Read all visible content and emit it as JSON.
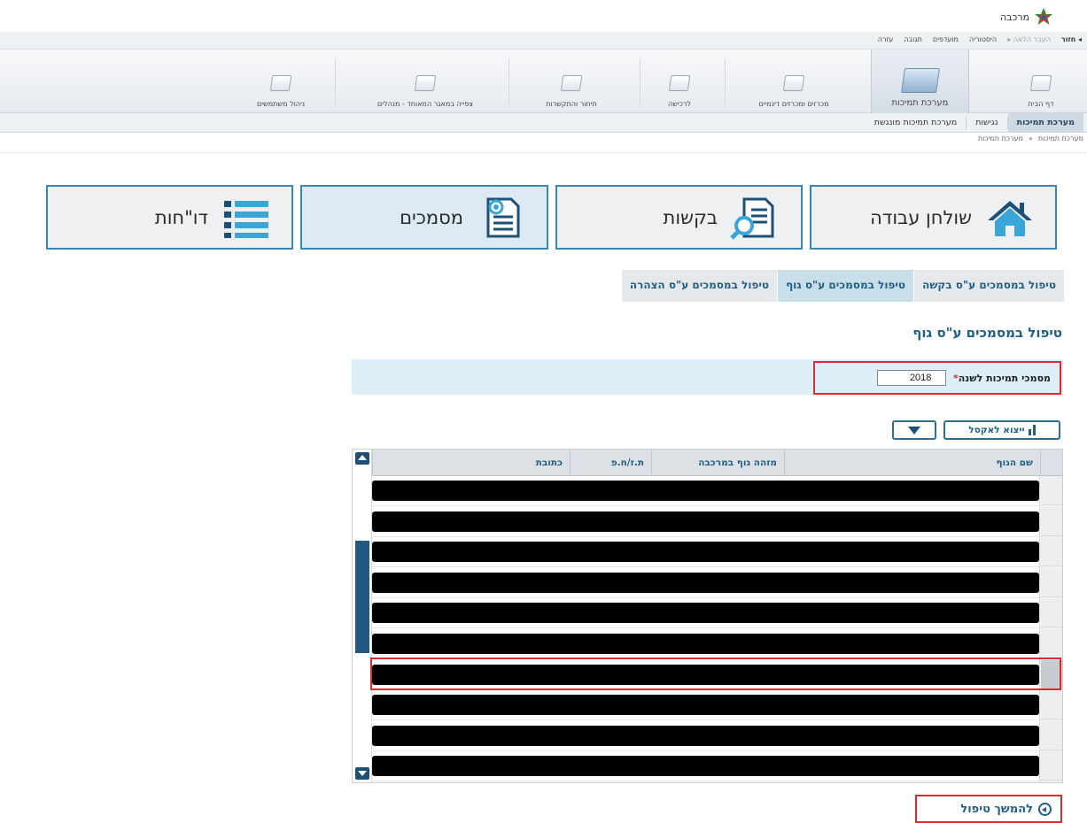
{
  "app": {
    "name": "מרכבה"
  },
  "history_bar": {
    "back": "חזור",
    "next_disabled": "העבר הלאה",
    "history": "היסטוריה",
    "favorites": "מועדפים",
    "feedback": "תגובה",
    "help": "עזרה"
  },
  "modules": [
    {
      "label": "דף הבית"
    },
    {
      "label": "מערכת תמיכות"
    },
    {
      "label": "מכרזים ומכרזים דינמיים"
    },
    {
      "label": "לרכישה"
    },
    {
      "label": "תיחור והתקשרות"
    },
    {
      "label": "צפייה במאגר המאוחד - מנהלים"
    },
    {
      "label": "ניהול משתמשים"
    }
  ],
  "subnav": [
    {
      "label": "מערכת תמיכות"
    },
    {
      "label": "נגישות"
    },
    {
      "label": "מערכת תמיכות מונגשת"
    }
  ],
  "breadcrumb": {
    "items": [
      "מערכת תמיכות",
      "»",
      "מערכת תמיכות"
    ]
  },
  "tiles": [
    {
      "label": "שולחן עבודה",
      "icon": "home-icon"
    },
    {
      "label": "בקשות",
      "icon": "document-search-icon"
    },
    {
      "label": "מסמכים",
      "icon": "documents-icon"
    },
    {
      "label": "דו\"חות",
      "icon": "list-icon"
    }
  ],
  "subtabs": [
    {
      "label": "טיפול במסמכים ע\"ס בקשה"
    },
    {
      "label": "טיפול במסמכים ע\"ס גוף"
    },
    {
      "label": "טיפול במסמכים ע\"ס הצהרה"
    }
  ],
  "section_title": "טיפול במסמכים ע\"ס גוף",
  "filter": {
    "label": "מסמכי תמיכות לשנה",
    "required_mark": "*",
    "year_value": "2018"
  },
  "toolbar": {
    "excel_label": "ייצוא לאקסל"
  },
  "grid": {
    "columns": [
      "שם הגוף",
      "מזהה גוף במרכבה",
      "ת.ז/ח.פ",
      "כתובת"
    ],
    "row_count": 10,
    "selected_row_index": 6
  },
  "continue_link": {
    "label": "להמשך טיפול"
  },
  "colors": {
    "accent_blue": "#1f5f86",
    "tile_border": "#3a88ae",
    "highlight_red": "#e0282e",
    "filter_bg": "#ddeef8"
  }
}
